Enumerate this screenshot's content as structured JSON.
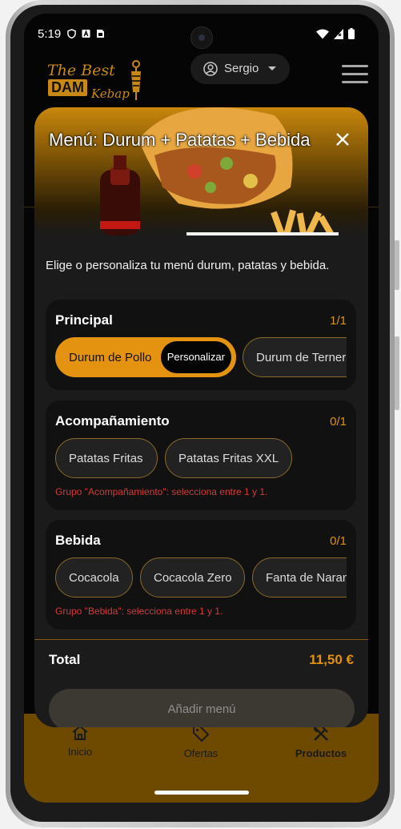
{
  "status_bar": {
    "time": "5:19"
  },
  "header": {
    "logo": {
      "line1": "The Best",
      "line2": "DAM",
      "line3": "Kebap"
    },
    "user": {
      "name": "Sergio"
    }
  },
  "modal": {
    "title": "Menú: Durum + Patatas + Bebida",
    "description": "Elige o personaliza tu menú durum, patatas y bebida.",
    "groups": [
      {
        "title": "Principal",
        "count": "1/1",
        "options": [
          {
            "label": "Durum de Pollo",
            "selected": true,
            "personalize_label": "Personalizar"
          },
          {
            "label": "Durum de Ternera",
            "selected": false
          }
        ],
        "error": ""
      },
      {
        "title": "Acompañamiento",
        "count": "0/1",
        "options": [
          {
            "label": "Patatas Fritas",
            "selected": false
          },
          {
            "label": "Patatas Fritas XXL",
            "selected": false
          }
        ],
        "error": "Grupo \"Acompañamiento\": selecciona entre 1 y 1."
      },
      {
        "title": "Bebida",
        "count": "0/1",
        "options": [
          {
            "label": "Cocacola",
            "selected": false
          },
          {
            "label": "Cocacola Zero",
            "selected": false
          },
          {
            "label": "Fanta de Naranja",
            "selected": false
          }
        ],
        "error": "Grupo \"Bebida\": selecciona entre 1 y 1."
      }
    ],
    "total_label": "Total",
    "total_value": "11,50 €",
    "add_button": "Añadir menú"
  },
  "bottom_nav": {
    "items": [
      {
        "label": "Inicio",
        "icon": "home-icon"
      },
      {
        "label": "Ofertas",
        "icon": "tag-icon"
      },
      {
        "label": "Productos",
        "icon": "utensils-icon"
      }
    ]
  },
  "colors": {
    "accent": "#e49310",
    "error": "#d33a3a",
    "nav_bg": "#6e4a00"
  }
}
